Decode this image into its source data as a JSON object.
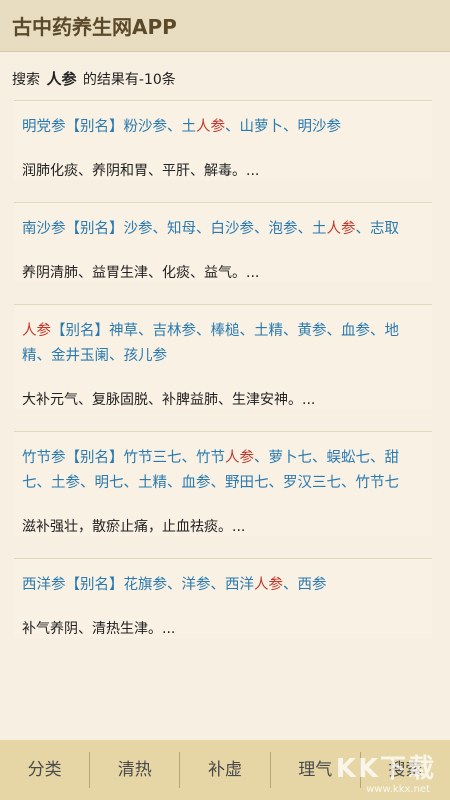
{
  "header": {
    "title": "古中药养生网APP"
  },
  "search_summary": {
    "prefix": "搜索",
    "keyword": "人参",
    "suffix": "的结果有-10条"
  },
  "results": [
    {
      "name": "明党参",
      "alias_label": "【别名】",
      "aliases_segments": [
        {
          "text": "粉沙参、土",
          "hit": false
        },
        {
          "text": "人参",
          "hit": true
        },
        {
          "text": "、山萝卜、明沙参",
          "hit": false
        }
      ],
      "desc": "润肺化痰、养阴和胃、平肝、解毒。..."
    },
    {
      "name": "南沙参",
      "alias_label": "【别名】",
      "aliases_segments": [
        {
          "text": "沙参、知母、白沙参、泡参、土",
          "hit": false
        },
        {
          "text": "人参",
          "hit": true
        },
        {
          "text": "、志取",
          "hit": false
        }
      ],
      "desc": "养阴清肺、益胃生津、化痰、益气。..."
    },
    {
      "name": "人参",
      "name_hit": true,
      "alias_label": "【别名】",
      "aliases_segments": [
        {
          "text": "神草、吉林参、棒槌、土精、黄参、血参、地精、金井玉阑、孩儿参",
          "hit": false
        }
      ],
      "desc": "大补元气、复脉固脱、补脾益肺、生津安神。..."
    },
    {
      "name": "竹节参",
      "alias_label": "【别名】",
      "aliases_segments": [
        {
          "text": "竹节三七、竹节",
          "hit": false
        },
        {
          "text": "人参",
          "hit": true
        },
        {
          "text": "、萝卜七、蜈蚣七、甜七、土参、明七、土精、血参、野田七、罗汉三七、竹节七",
          "hit": false
        }
      ],
      "desc": "滋补强壮，散瘀止痛，止血祛痰。..."
    },
    {
      "name": "西洋参",
      "alias_label": "【别名】",
      "aliases_segments": [
        {
          "text": "花旗参、洋参、西洋",
          "hit": false
        },
        {
          "text": "人参",
          "hit": true
        },
        {
          "text": "、西参",
          "hit": false
        }
      ],
      "desc": "补气养阴、清热生津。..."
    }
  ],
  "tabs": [
    "分类",
    "清热",
    "补虚",
    "理气",
    "搜索"
  ],
  "watermark": {
    "text": "KK下载",
    "url": "www.kkx.net"
  }
}
